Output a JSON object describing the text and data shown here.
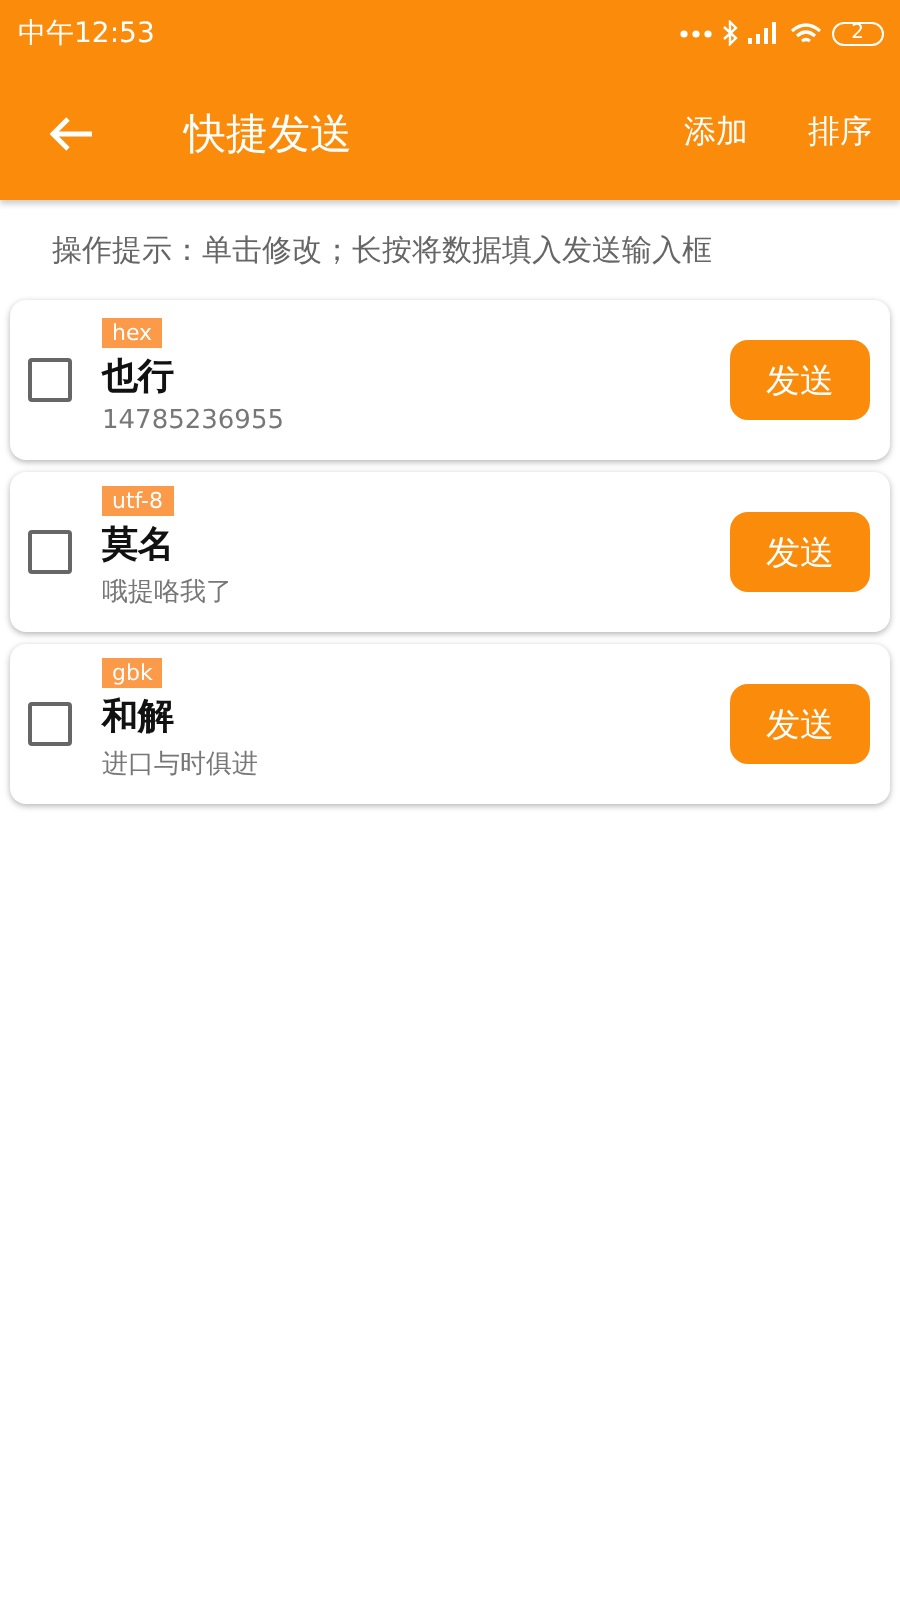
{
  "status_bar": {
    "time": "中午12:53",
    "battery": "2"
  },
  "app_bar": {
    "title": "快捷发送",
    "actions": [
      "添加",
      "排序"
    ]
  },
  "hint": "操作提示：单击修改；长按将数据填入发送输入框",
  "items": [
    {
      "encoding": "hex",
      "name": "也行",
      "content": "14785236955",
      "checked": false,
      "button": "发送"
    },
    {
      "encoding": "utf-8",
      "name": "莫名",
      "content": "哦提咯我了",
      "checked": false,
      "button": "发送"
    },
    {
      "encoding": "gbk",
      "name": "和解",
      "content": "进口与时俱进",
      "checked": false,
      "button": "发送"
    }
  ]
}
